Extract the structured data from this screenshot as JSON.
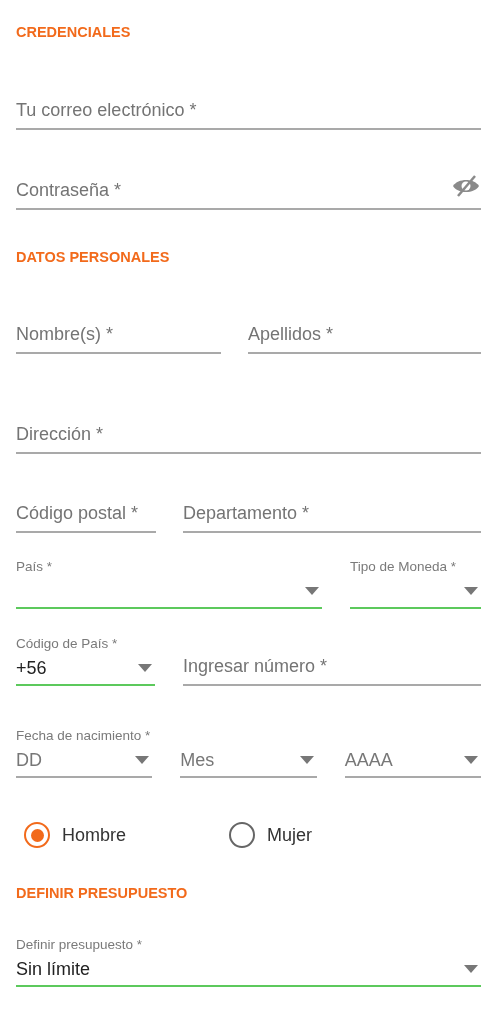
{
  "credentials": {
    "title": "CREDENCIALES",
    "email": {
      "placeholder": "Tu correo electrónico *"
    },
    "password": {
      "placeholder": "Contraseña *",
      "visible": false
    }
  },
  "personal": {
    "title": "DATOS PERSONALES",
    "first_name": {
      "placeholder": "Nombre(s) *"
    },
    "last_name": {
      "placeholder": "Apellidos *"
    },
    "address": {
      "placeholder": "Dirección *"
    },
    "postal_code": {
      "placeholder": "Código postal *"
    },
    "department": {
      "placeholder": "Departamento *"
    },
    "country": {
      "label": "País *",
      "highlighted": true
    },
    "currency": {
      "label": "Tipo de Moneda *",
      "highlighted": true
    },
    "country_code": {
      "label": "Código de País *",
      "value": "+56",
      "highlighted": true
    },
    "phone": {
      "placeholder": "Ingresar número *"
    },
    "birth_date": {
      "label": "Fecha de nacimiento *",
      "parts": [
        {
          "placeholder": "DD",
          "highlighted": false
        },
        {
          "placeholder": "Mes",
          "highlighted": false
        },
        {
          "placeholder": "AAAA",
          "highlighted": false
        }
      ]
    },
    "gender": [
      {
        "label": "Hombre",
        "selected": true
      },
      {
        "label": "Mujer",
        "selected": false
      }
    ]
  },
  "budget": {
    "title": "DEFINIR PRESUPUESTO",
    "select": {
      "label": "Definir presupuesto *",
      "value": "Sin límite",
      "highlighted": true
    }
  }
}
